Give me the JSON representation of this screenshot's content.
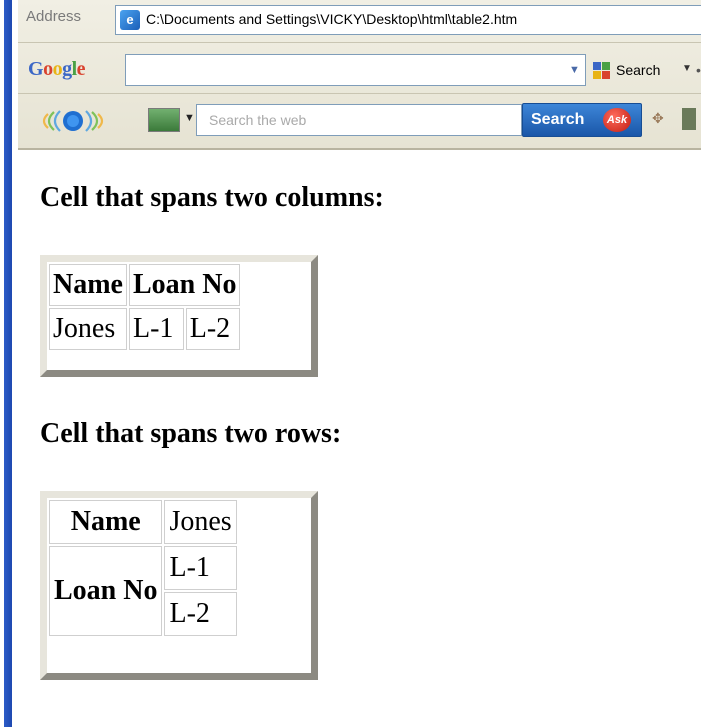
{
  "browser": {
    "address_label": "Address",
    "address_url": "C:\\Documents and Settings\\VICKY\\Desktop\\html\\table2.htm",
    "google_toolbar": {
      "logo": "Google",
      "search_label": "Search",
      "search_icon": "google-search-icon"
    },
    "ask_toolbar": {
      "search_placeholder": "Search the web",
      "search_button_label": "Search",
      "badge_text": "Ask"
    }
  },
  "content": {
    "heading_colspan": "Cell that spans two columns:",
    "table_colspan": {
      "headers": [
        "Name",
        "Loan No"
      ],
      "row": [
        "Jones",
        "L-1",
        "L-2"
      ]
    },
    "heading_rowspan": "Cell that spans two rows:",
    "table_rowspan": {
      "name_label": "Name",
      "name_value": "Jones",
      "loan_label": "Loan No",
      "loan_values": [
        "L-1",
        "L-2"
      ]
    }
  },
  "colors": {
    "frame_blue": "#2c5bc7",
    "ask_button": "#1a56a8"
  }
}
